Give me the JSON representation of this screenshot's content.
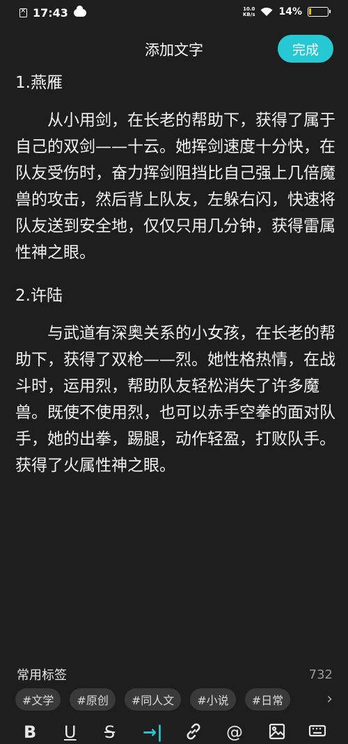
{
  "status": {
    "time": "17:43",
    "net_speed_value": "10.0",
    "net_speed_unit": "KB/s",
    "battery": "14%",
    "battery_level": 0.14,
    "battery_color": "#f2c400"
  },
  "header": {
    "title": "添加文字",
    "done_label": "完成",
    "accent_color": "#26c9d3"
  },
  "content": {
    "heading1": "1.燕雁",
    "para1": "从小用剑，在长老的帮助下，获得了属于自己的双剑——十云。她挥剑速度十分快，在队友受伤时，奋力挥剑阻挡比自己强上几倍魔兽的攻击，然后背上队友，左躲右闪，快速将队友送到安全地，仅仅只用几分钟，获得雷属性神之眼。",
    "heading2": "2.许陆",
    "para2": "与武道有深奥关系的小女孩，在长老的帮助下，获得了双枪——烈。她性格热情，在战斗时，运用烈，帮助队友轻松消失了许多魔兽。既使不使用烈，也可以赤手空拳的面对队手，她的出拳，踢腿，动作轻盈，打败队手。获得了火属性神之眼。"
  },
  "tags_section": {
    "label": "常用标签",
    "count": "732",
    "tags": [
      "#文学",
      "#原创",
      "#同人文",
      "#小说",
      "#日常"
    ]
  },
  "toolbar": {
    "bold": "B",
    "underline": "U",
    "strike": "S",
    "indent": "→|",
    "at": "@"
  }
}
